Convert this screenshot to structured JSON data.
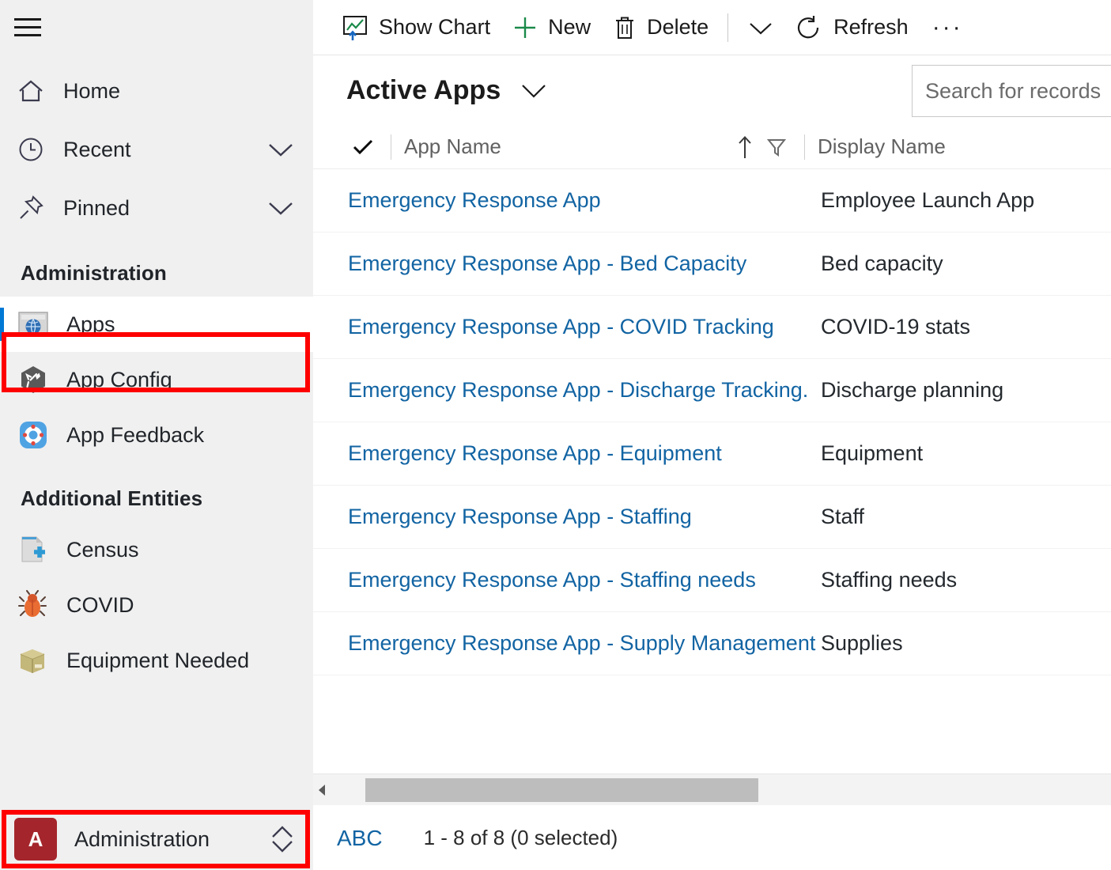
{
  "sidebar": {
    "menu_icon": "hamburger-icon",
    "nav": [
      {
        "label": "Home",
        "icon": "home-icon",
        "chevron": false
      },
      {
        "label": "Recent",
        "icon": "clock-icon",
        "chevron": true
      },
      {
        "label": "Pinned",
        "icon": "pin-icon",
        "chevron": true
      }
    ],
    "groups": [
      {
        "title": "Administration",
        "items": [
          {
            "label": "Apps",
            "icon": "globe-window-icon",
            "selected": true
          },
          {
            "label": "App Config",
            "icon": "hexagon-wrench-icon",
            "selected": false
          },
          {
            "label": "App Feedback",
            "icon": "lifesaver-icon",
            "selected": false
          }
        ]
      },
      {
        "title": "Additional Entities",
        "items": [
          {
            "label": "Census",
            "icon": "document-plus-icon",
            "selected": false
          },
          {
            "label": "COVID",
            "icon": "bug-icon",
            "selected": false
          },
          {
            "label": "Equipment Needed",
            "icon": "box-icon",
            "selected": false
          }
        ]
      }
    ],
    "app_switcher": {
      "badge": "A",
      "label": "Administration",
      "badge_color": "#a4262c",
      "expand_icon": "chevron-up-down-icon"
    }
  },
  "commandbar": {
    "show_chart": "Show Chart",
    "new": "New",
    "delete": "Delete",
    "refresh": "Refresh",
    "overflow": "···",
    "icons": {
      "show_chart": "chart-icon",
      "new": "plus-icon",
      "delete": "trash-icon",
      "more": "chevron-down-icon",
      "refresh": "refresh-icon",
      "overflow": "ellipsis-icon"
    }
  },
  "view": {
    "title": "Active Apps",
    "chevron_icon": "chevron-down-icon"
  },
  "search": {
    "placeholder": "Search for records",
    "value": ""
  },
  "grid": {
    "select_all_icon": "checkmark-icon",
    "sort_icon": "sort-ascending-icon",
    "filter_icon": "filter-icon",
    "columns": [
      "App Name",
      "Display Name"
    ],
    "rows": [
      {
        "app_name": "Emergency Response App",
        "display_name": "Employee Launch App"
      },
      {
        "app_name": "Emergency Response App - Bed Capacity",
        "display_name": "Bed capacity"
      },
      {
        "app_name": "Emergency Response App - COVID Tracking",
        "display_name": "COVID-19 stats"
      },
      {
        "app_name": "Emergency Response App - Discharge Tracking.",
        "display_name": "Discharge planning"
      },
      {
        "app_name": "Emergency Response App - Equipment",
        "display_name": "Equipment"
      },
      {
        "app_name": "Emergency Response App - Staffing",
        "display_name": "Staff"
      },
      {
        "app_name": "Emergency Response App - Staffing needs",
        "display_name": "Staffing needs"
      },
      {
        "app_name": "Emergency Response App - Supply Management",
        "display_name": "Supplies"
      }
    ]
  },
  "footer": {
    "alpha_index": "ABC",
    "record_count": "1 - 8 of 8 (0 selected)"
  },
  "annotations": {
    "highlight_color": "#ff0000",
    "boxes": [
      "apps-nav-item",
      "app-switcher"
    ]
  },
  "colors": {
    "accent": "#0078d4",
    "link": "#1264a3",
    "sidebar_bg": "#f0f0f0",
    "badge": "#a4262c"
  }
}
